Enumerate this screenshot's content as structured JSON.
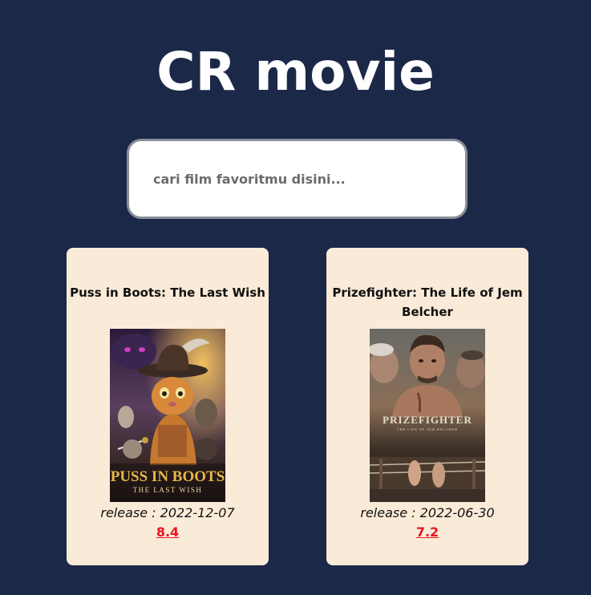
{
  "app": {
    "title": "CR movie"
  },
  "search": {
    "placeholder": "cari film favoritmu disini...",
    "value": ""
  },
  "colors": {
    "background": "#1b2848",
    "card": "#faebd8",
    "rating": "#e8141e"
  },
  "movies": [
    {
      "title": "Puss in Boots: The Last Wish",
      "release_label": "release : 2022-12-07",
      "rating": "8.4",
      "poster_title_line1": "PUSS IN BOOTS",
      "poster_title_line2": "THE LAST WISH"
    },
    {
      "title": "Prizefighter: The Life of Jem Belcher",
      "release_label": "release : 2022-06-30",
      "rating": "7.2",
      "poster_title_line1": "PRIZEFIGHTER",
      "poster_title_line2": "THE LIFE OF JEM BELCHER"
    }
  ]
}
